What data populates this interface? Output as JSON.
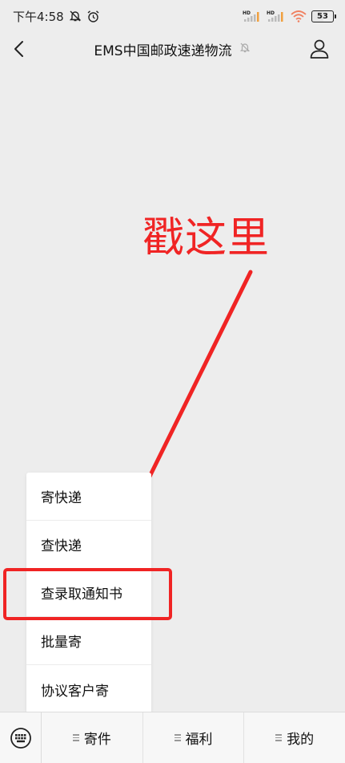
{
  "status_bar": {
    "time": "下午4:58",
    "network_label_1": "HD",
    "network_label_2": "HD",
    "battery_level": "53",
    "icons": [
      "mute-icon",
      "alarm-icon",
      "signal-icon",
      "wifi-icon",
      "battery-icon"
    ]
  },
  "header": {
    "title": "EMS中国邮政速递物流",
    "icons": [
      "back-icon",
      "mute-notifications-icon",
      "profile-icon"
    ]
  },
  "annotation": {
    "text": "戳这里",
    "color": "#f02424"
  },
  "popup_menu": {
    "items": [
      {
        "label": "寄快递"
      },
      {
        "label": "查快递"
      },
      {
        "label": "查录取通知书"
      },
      {
        "label": "批量寄"
      },
      {
        "label": "协议客户寄"
      }
    ]
  },
  "bottom_bar": {
    "tabs": [
      {
        "label": "寄件"
      },
      {
        "label": "福利"
      },
      {
        "label": "我的"
      }
    ],
    "icons": [
      "keyboard-icon",
      "menu-lines-icon"
    ]
  }
}
